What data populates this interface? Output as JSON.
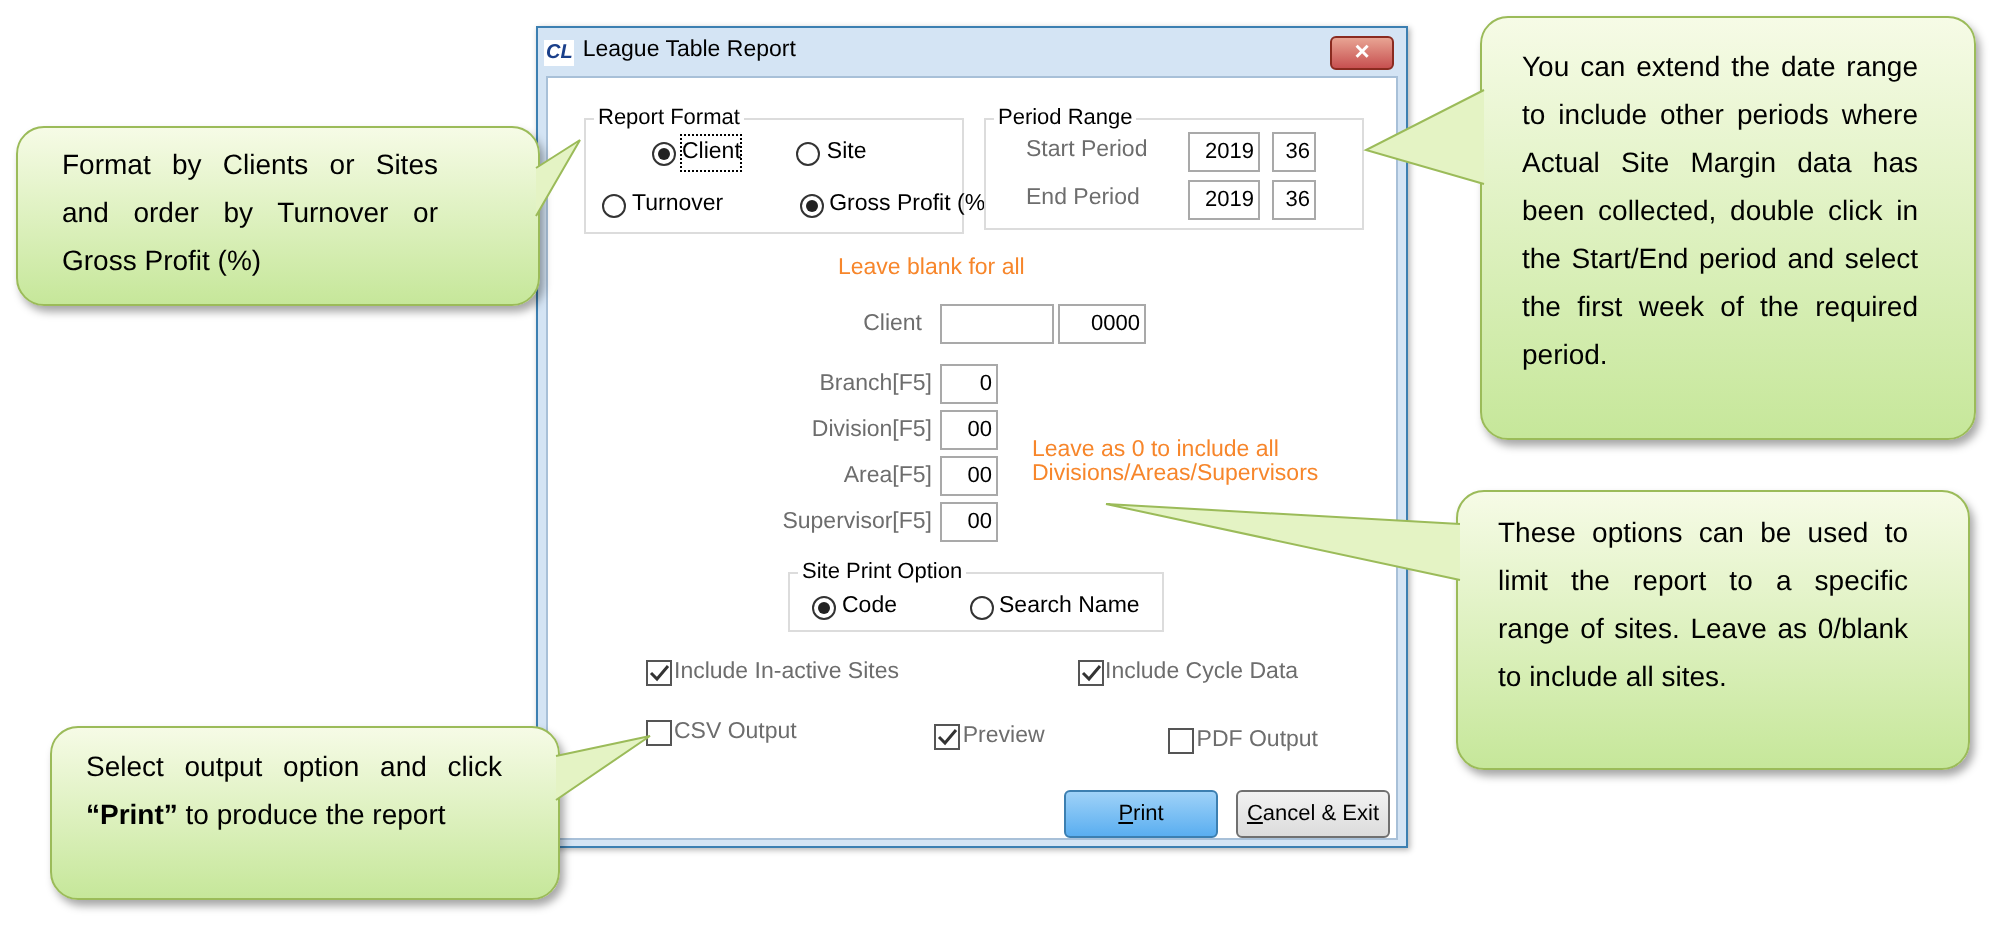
{
  "window": {
    "logo": "CL",
    "title": "League Table Report",
    "close_label": "×"
  },
  "report_format": {
    "label": "Report Format",
    "group_by": [
      {
        "label": "Client",
        "selected": true,
        "focused": true
      },
      {
        "label": "Site",
        "selected": false,
        "focused": false
      }
    ],
    "order_by": [
      {
        "label": "Turnover",
        "selected": false,
        "focused": false
      },
      {
        "label": "Gross Profit (%",
        "selected": true,
        "focused": false
      }
    ]
  },
  "period_range": {
    "label": "Period Range",
    "rows": [
      {
        "label": "Start Period",
        "year": "2019",
        "week": "36"
      },
      {
        "label": "End Period",
        "year": "2019",
        "week": "36"
      }
    ]
  },
  "client_hint": "Leave blank for all",
  "client": {
    "label": "Client",
    "number": "0000"
  },
  "filters": [
    {
      "label": "Branch[F5]",
      "value": "0"
    },
    {
      "label": "Division[F5]",
      "value": "00"
    },
    {
      "label": "Area[F5]",
      "value": "00"
    },
    {
      "label": "Supervisor[F5]",
      "value": "00"
    }
  ],
  "filters_note": [
    "Leave as 0 to include all",
    "Divisions/Areas/Supervisors"
  ],
  "site_print_option": {
    "label": "Site Print Option",
    "options": [
      {
        "label": "Code",
        "selected": true
      },
      {
        "label": "Search Name",
        "selected": false
      }
    ]
  },
  "include_options": [
    {
      "label": "Include In-active Sites",
      "checked": true
    },
    {
      "label": "Include Cycle Data",
      "checked": true
    }
  ],
  "output_options": [
    {
      "label": "CSV Output",
      "checked": false
    },
    {
      "label": "Preview",
      "checked": true
    },
    {
      "label": "PDF Output",
      "checked": false
    }
  ],
  "buttons": [
    {
      "label": "Print",
      "kind": "default",
      "mnemonic": true
    },
    {
      "label": "Cancel & Exit",
      "kind": "normal",
      "mnemonic": true
    }
  ],
  "callouts": [
    {
      "text": "Format by Clients or Sites and order by Turnover or Gross Profit (%)"
    },
    {
      "text": "You can extend the date range to include other periods where Actual Site Margin data has been collected, double click in the Start/End period and select the first week of the required period."
    },
    {
      "text": "These options can be used to limit the report to a specific range of sites. Leave as 0/blank to include all sites."
    },
    {
      "text": "Select output option and click **“Print”** to produce the report"
    }
  ]
}
